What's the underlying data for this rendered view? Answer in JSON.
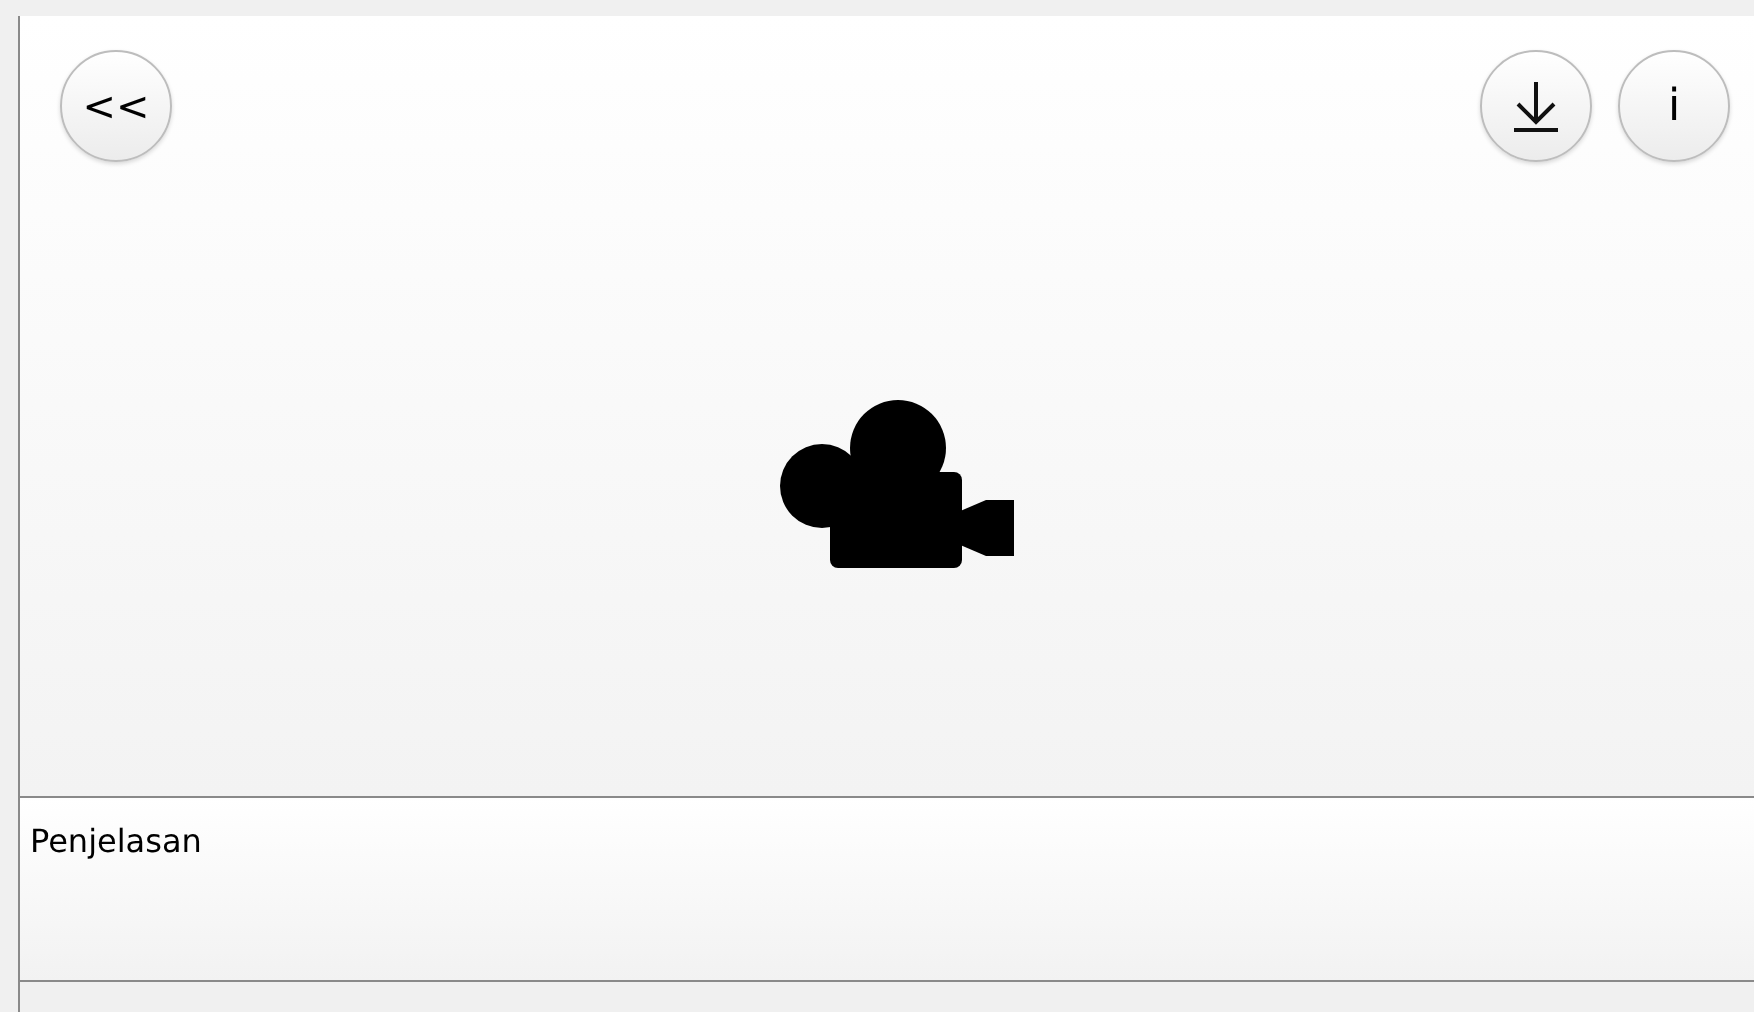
{
  "toolbar": {
    "back_button": {
      "label": "<<"
    },
    "info_button": {
      "label": "i"
    }
  },
  "description": {
    "text": "Penjelasan"
  }
}
